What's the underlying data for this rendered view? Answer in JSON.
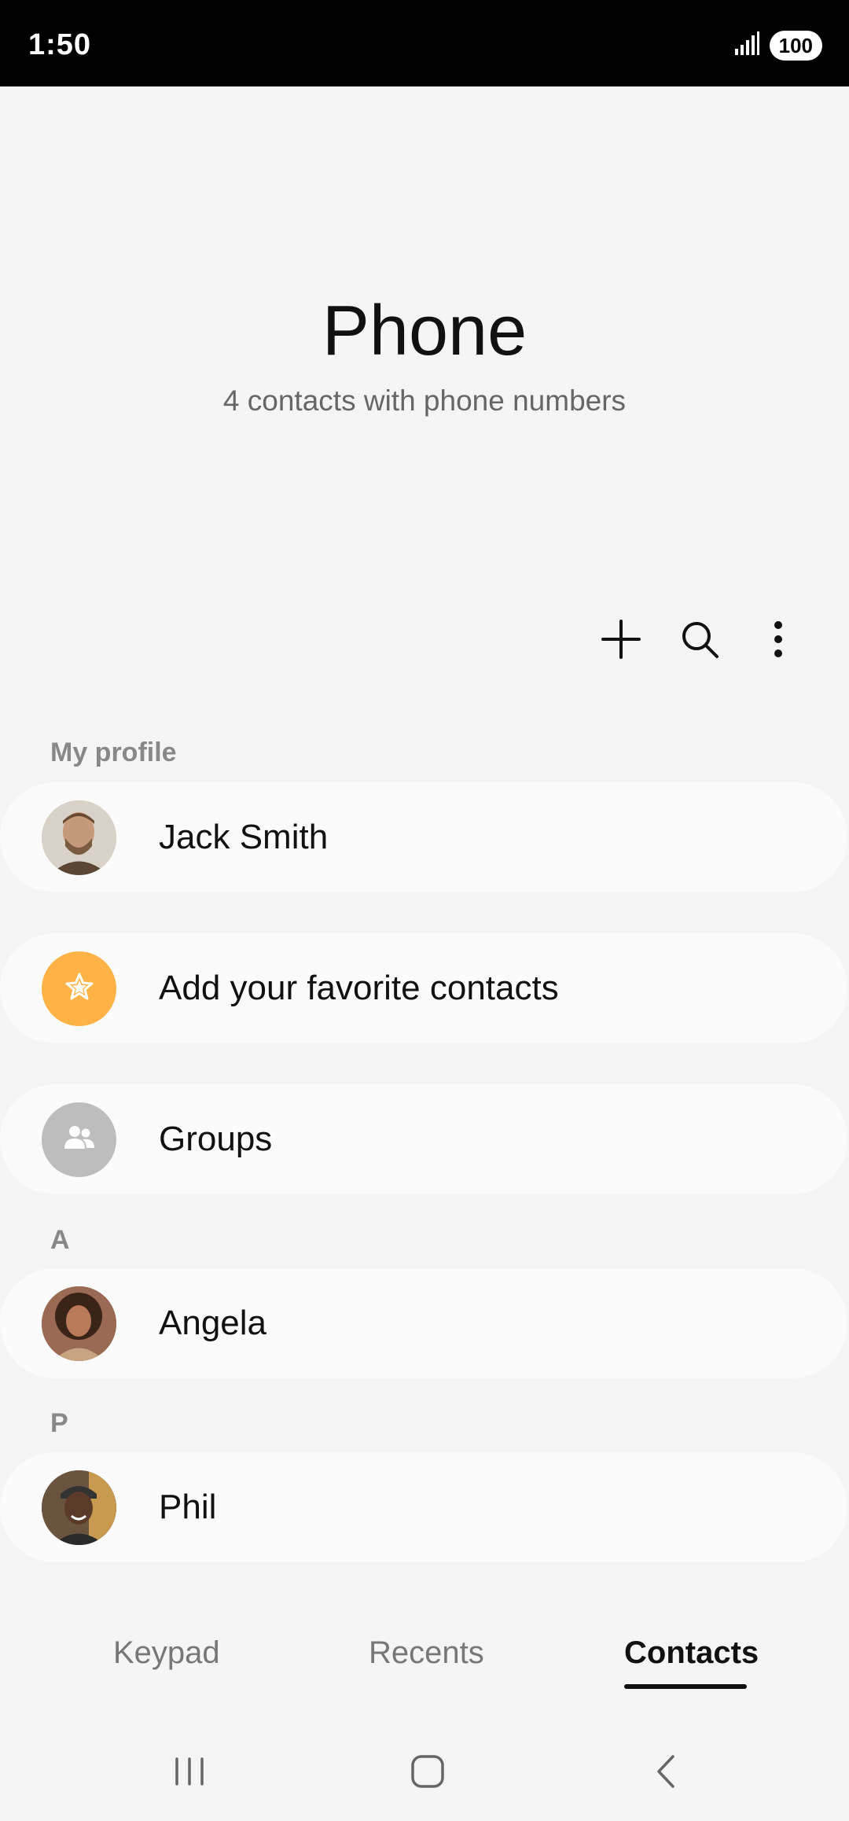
{
  "status_bar": {
    "time": "1:50",
    "battery": "100"
  },
  "header": {
    "title": "Phone",
    "subtitle": "4 contacts with phone numbers"
  },
  "toolbar": {
    "add_icon": "plus-icon",
    "search_icon": "search-icon",
    "more_icon": "more-vert-icon"
  },
  "my_profile": {
    "section_label": "My profile",
    "name": "Jack Smith"
  },
  "favorites": {
    "label": "Add your favorite contacts",
    "icon": "star-icon",
    "icon_bg": "#ffb347"
  },
  "groups": {
    "label": "Groups",
    "icon": "people-icon",
    "icon_bg": "#bdbdbd"
  },
  "contacts": {
    "sections": [
      {
        "letter": "A",
        "items": [
          {
            "name": "Angela"
          }
        ]
      },
      {
        "letter": "P",
        "items": [
          {
            "name": "Phil"
          }
        ]
      }
    ]
  },
  "bottom_tabs": [
    {
      "label": "Keypad",
      "active": false
    },
    {
      "label": "Recents",
      "active": false
    },
    {
      "label": "Contacts",
      "active": true
    }
  ],
  "nav_bar": {
    "recents_icon": "recent-apps-icon",
    "home_icon": "home-icon",
    "back_icon": "back-icon"
  }
}
